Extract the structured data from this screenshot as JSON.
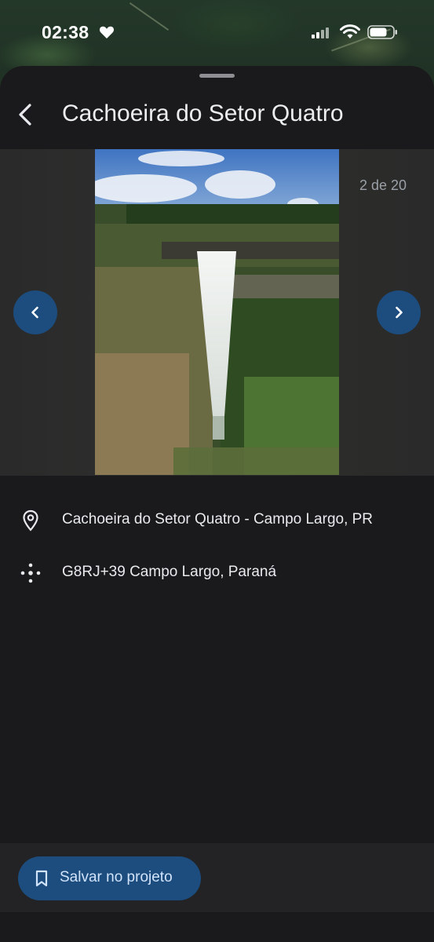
{
  "status_bar": {
    "time": "02:38"
  },
  "header": {
    "title": "Cachoeira do Setor Quatro"
  },
  "carousel": {
    "counter": "2 de 20"
  },
  "details": {
    "address": "Cachoeira do Setor Quatro - Campo Largo, PR",
    "plus_code": "G8RJ+39 Campo Largo, Paraná"
  },
  "actions": {
    "save_label": "Salvar no projeto"
  },
  "colors": {
    "accent_button": "#1c4d7e",
    "sheet_background": "#1a1a1c"
  },
  "icons": {
    "back": "back-arrow-icon",
    "prev": "chevron-left-icon",
    "next": "chevron-right-icon",
    "address": "location-pin-icon",
    "plus_code": "plus-code-icon",
    "save": "bookmark-icon"
  }
}
